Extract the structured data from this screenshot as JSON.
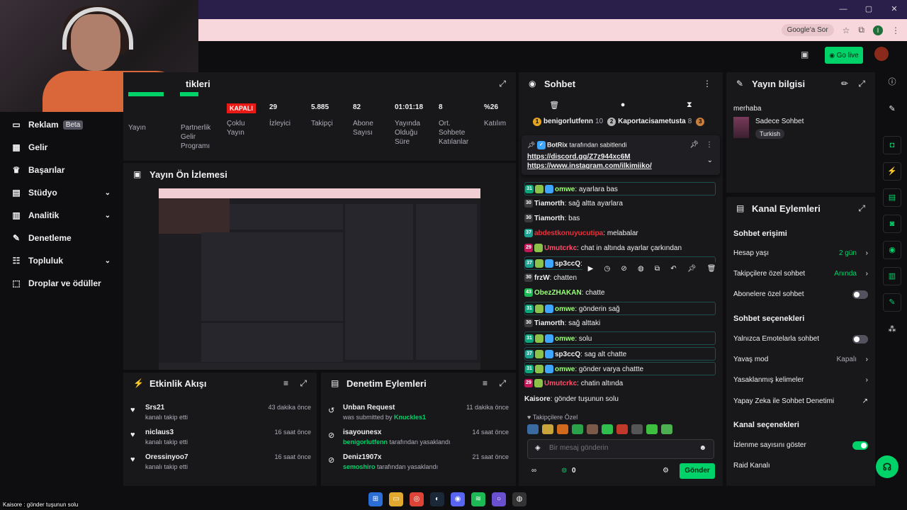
{
  "browser": {
    "google_button": "Google'a Sor",
    "profile_initial": "I",
    "window_controls": [
      "—",
      "▢",
      "✕"
    ]
  },
  "topbar": {
    "go_live": "Go live"
  },
  "nav": {
    "items": [
      {
        "label": "Reklam",
        "badge": "Beta",
        "icon": "ad-icon"
      },
      {
        "label": "Gelir",
        "icon": "revenue-icon"
      },
      {
        "label": "Başarılar",
        "icon": "trophy-icon"
      },
      {
        "label": "Stüdyo",
        "icon": "studio-icon",
        "expandable": true
      },
      {
        "label": "Analitik",
        "icon": "analytics-icon",
        "expandable": true
      },
      {
        "label": "Denetleme",
        "icon": "wrench-icon"
      },
      {
        "label": "Topluluk",
        "icon": "community-icon",
        "expandable": true
      },
      {
        "label": "Droplar ve ödüller",
        "icon": "gift-icon"
      }
    ]
  },
  "stats": {
    "title": "tikleri",
    "items": [
      {
        "value": "",
        "label": "Yayın"
      },
      {
        "value": "",
        "label": "Partnerlik Gelir Programı"
      },
      {
        "value": "KAPALI",
        "label": "Çoklu Yayın"
      },
      {
        "value": "29",
        "label": "İzleyici"
      },
      {
        "value": "5.885",
        "label": "Takipçi"
      },
      {
        "value": "82",
        "label": "Abone Sayısı"
      },
      {
        "value": "01:01:18",
        "label": "Yayında Olduğu Süre"
      },
      {
        "value": "8",
        "label": "Ort. Sohbete Katılanlar"
      },
      {
        "value": "%26",
        "label": "Katılım"
      }
    ]
  },
  "preview": {
    "title": "Yayın Ön İzlemesi"
  },
  "activity": {
    "title": "Etkinlik Akışı",
    "items": [
      {
        "name": "Srs21",
        "sub": "kanalı takip etti",
        "time": "43 dakika önce"
      },
      {
        "name": "niclaus3",
        "sub": "kanalı takip etti",
        "time": "16 saat önce"
      },
      {
        "name": "Oressinyoo7",
        "sub": "kanalı takip etti",
        "time": "16 saat önce"
      }
    ]
  },
  "moderation": {
    "title": "Denetim Eylemleri",
    "items": [
      {
        "name": "Unban Request",
        "sub_pre": "was submitted by ",
        "sub_user": "Knuckles1",
        "sub_post": "",
        "time": "11 dakika önce"
      },
      {
        "name": "isayounesx",
        "sub_pre": "",
        "sub_user": "benigorlutfenn",
        "sub_post": " tarafından yasaklandı",
        "time": "14 saat önce"
      },
      {
        "name": "Deniz1907x",
        "sub_pre": "",
        "sub_user": "semoshiro",
        "sub_post": " tarafından yasaklandı",
        "time": "21 saat önce"
      }
    ]
  },
  "chat": {
    "title": "Sohbet",
    "leaders": [
      {
        "rank": "1",
        "name": "benigorlutfenn",
        "count": "10",
        "tier": "gold"
      },
      {
        "rank": "2",
        "name": "Kaportacisametusta",
        "count": "8",
        "tier": "silver"
      },
      {
        "rank": "3",
        "name": "",
        "count": "",
        "tier": "bronze"
      }
    ],
    "pinned": {
      "by": "BotRix",
      "by_suffix": " tarafından sabitlendi",
      "link1": "https://discord.gg/Z7z944xc6M",
      "link2": "https://www.instagram.com/ilkimiiko/"
    },
    "messages": [
      {
        "badges": [
          "31",
          "gem",
          "blue"
        ],
        "user": "omwe",
        "color": "#9bff7a",
        "text": "ayarlara bas",
        "boxed": true
      },
      {
        "badges": [
          "30"
        ],
        "user": "Tiamorth",
        "color": "#efeff1",
        "text": "sağ altta ayarlara",
        "boxed": false
      },
      {
        "badges": [
          "30"
        ],
        "user": "Tiamorth",
        "color": "#efeff1",
        "text": "bas",
        "boxed": false
      },
      {
        "badges": [
          "37"
        ],
        "user": "abdestkonuyucutipa",
        "color": "#e8323c",
        "text": "melabalar",
        "boxed": false
      },
      {
        "badges": [
          "29",
          "gem"
        ],
        "user": "Umutcrkc",
        "color": "#ff4f6a",
        "text": "chat in altında ayarlar çarkından",
        "boxed": false
      },
      {
        "badges": [
          "37",
          "gem",
          "blue"
        ],
        "user": "sp3ccQ",
        "color": "#efeff1",
        "text": "",
        "boxed": true
      },
      {
        "badges": [
          "30"
        ],
        "user": "frzW",
        "color": "#efeff1",
        "text": "chatten",
        "boxed": false
      },
      {
        "badges": [
          "43"
        ],
        "user": "ObezZHAKAN",
        "color": "#9bff7a",
        "text": "chatte",
        "boxed": false
      },
      {
        "badges": [
          "31",
          "gem",
          "blue"
        ],
        "user": "omwe",
        "color": "#9bff7a",
        "text": "gönderin sağ",
        "boxed": true
      },
      {
        "badges": [
          "30"
        ],
        "user": "Tiamorth",
        "color": "#efeff1",
        "text": "sağ alttaki",
        "boxed": false
      },
      {
        "badges": [
          "31",
          "gem",
          "blue"
        ],
        "user": "omwe",
        "color": "#9bff7a",
        "text": "solu",
        "boxed": true
      },
      {
        "badges": [
          "37",
          "gem",
          "blue"
        ],
        "user": "sp3ccQ",
        "color": "#efeff1",
        "text": "sag alt chatte",
        "boxed": true
      },
      {
        "badges": [
          "31",
          "gem",
          "blue"
        ],
        "user": "omwe",
        "color": "#9bff7a",
        "text": "gönder varya chattte",
        "boxed": true
      },
      {
        "badges": [
          "29",
          "gem"
        ],
        "user": "Umutcrkc",
        "color": "#ff4f6a",
        "text": "chatin altında",
        "boxed": false
      },
      {
        "badges": [],
        "user": "Kaisore",
        "color": "#efeff1",
        "text": "gönder tuşunun solu",
        "boxed": false
      }
    ],
    "follower_only": "Takipçilere Özel",
    "placeholder": "Bir mesaj gönderin",
    "points": "0",
    "send": "Gönder"
  },
  "stream_info": {
    "title": "Yayın bilgisi",
    "stream_title": "merhaba",
    "category": "Sadece Sohbet",
    "tag": "Turkish"
  },
  "channel_actions": {
    "title": "Kanal Eylemleri",
    "chat_access": "Sohbet erişimi",
    "account_age": {
      "label": "Hesap yaşı",
      "value": "2 gün"
    },
    "follower_chat": {
      "label": "Takipçilere özel sohbet",
      "value": "Anında"
    },
    "sub_chat": {
      "label": "Abonelere özel sohbet",
      "on": false
    },
    "chat_options": "Sohbet seçenekleri",
    "emote_only": {
      "label": "Yalnızca Emotelarla sohbet",
      "on": false
    },
    "slow_mode": {
      "label": "Yavaş mod",
      "value": "Kapalı"
    },
    "banned_words": {
      "label": "Yasaklanmış kelimeler"
    },
    "ai_mod": {
      "label": "Yapay Zeka ile Sohbet Denetimi"
    },
    "channel_options": "Kanal seçenekleri",
    "show_viewers": {
      "label": "İzlenme sayısını göster",
      "on": true
    },
    "raid": {
      "label": "Raid Kanalı"
    }
  },
  "subtitle": "Kaisore : gönder tuşunun solu"
}
